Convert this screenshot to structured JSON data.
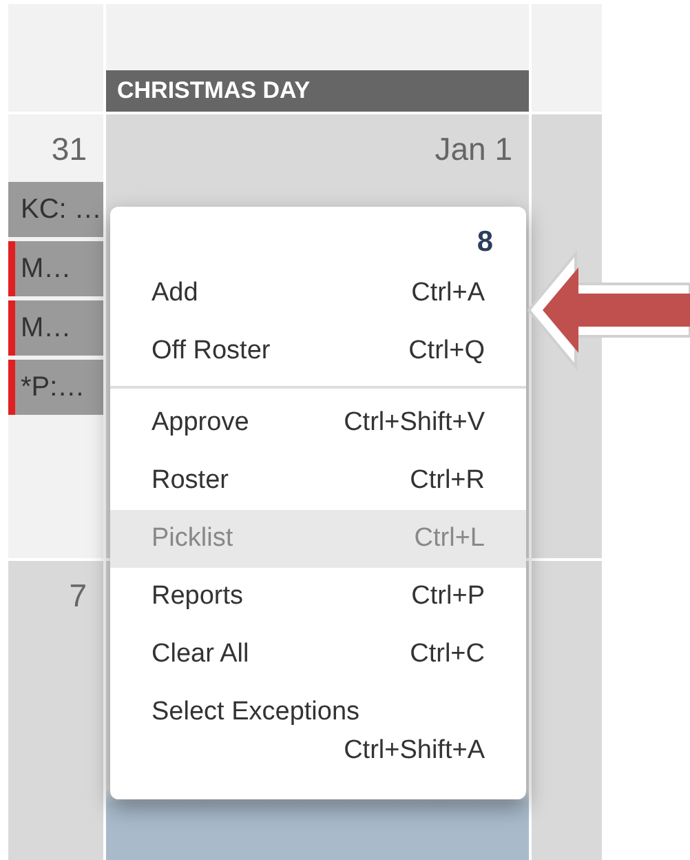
{
  "calendar": {
    "holiday_banner": "CHRISTMAS DAY",
    "days": [
      {
        "label": "31",
        "events": [
          {
            "text": "KC: …",
            "flagged": false
          },
          {
            "text": "M…",
            "flagged": true
          },
          {
            "text": "M…",
            "flagged": true
          },
          {
            "text": "*P:…",
            "flagged": true
          }
        ]
      },
      {
        "label": "Jan 1"
      },
      {
        "label": "7"
      }
    ]
  },
  "context_menu": {
    "count": "8",
    "sections": [
      [
        {
          "label": "Add",
          "shortcut": "Ctrl+A",
          "selected": false
        },
        {
          "label": "Off Roster",
          "shortcut": "Ctrl+Q",
          "selected": false
        }
      ],
      [
        {
          "label": "Approve",
          "shortcut": "Ctrl+Shift+V",
          "selected": false
        },
        {
          "label": "Roster",
          "shortcut": "Ctrl+R",
          "selected": false
        },
        {
          "label": "Picklist",
          "shortcut": "Ctrl+L",
          "selected": true
        },
        {
          "label": "Reports",
          "shortcut": "Ctrl+P",
          "selected": false
        },
        {
          "label": "Clear All",
          "shortcut": "Ctrl+C",
          "selected": false
        },
        {
          "label": "Select Exceptions",
          "shortcut": "Ctrl+Shift+A",
          "selected": false
        }
      ]
    ]
  }
}
